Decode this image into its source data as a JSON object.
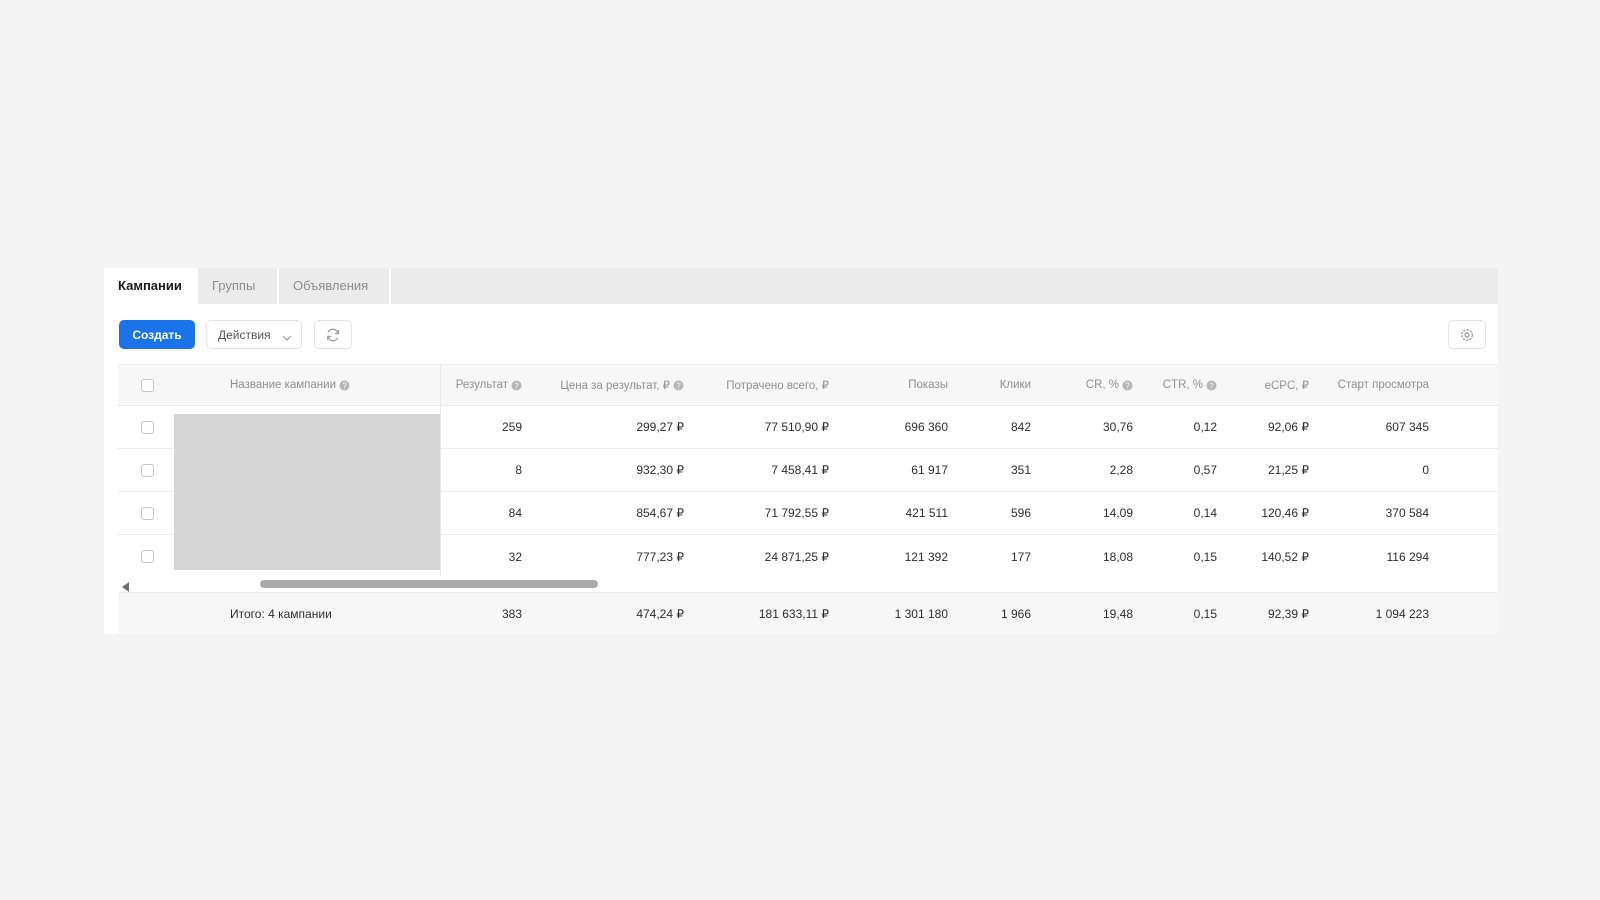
{
  "tabs": [
    {
      "label": "Кампании",
      "active": true
    },
    {
      "label": "Группы",
      "active": false
    },
    {
      "label": "Объявления",
      "active": false
    }
  ],
  "toolbar": {
    "create_label": "Создать",
    "actions_label": "Действия",
    "accent_color": "#1a73e8"
  },
  "table": {
    "headers": {
      "name": "Название кампании",
      "result": "Результат",
      "price": "Цена за результат, ₽",
      "spent": "Потрачено всего, ₽",
      "impressions": "Показы",
      "clicks": "Клики",
      "cr": "CR, %",
      "ctr": "CTR, %",
      "ecpc": "eCPC, ₽",
      "start_view": "Старт просмотра"
    },
    "rows": [
      {
        "result": "259",
        "price": "299,27 ₽",
        "spent": "77 510,90 ₽",
        "impressions": "696 360",
        "clicks": "842",
        "cr": "30,76",
        "ctr": "0,12",
        "ecpc": "92,06 ₽",
        "start_view": "607 345"
      },
      {
        "result": "8",
        "price": "932,30 ₽",
        "spent": "7 458,41 ₽",
        "impressions": "61 917",
        "clicks": "351",
        "cr": "2,28",
        "ctr": "0,57",
        "ecpc": "21,25 ₽",
        "start_view": "0"
      },
      {
        "result": "84",
        "price": "854,67 ₽",
        "spent": "71 792,55 ₽",
        "impressions": "421 511",
        "clicks": "596",
        "cr": "14,09",
        "ctr": "0,14",
        "ecpc": "120,46 ₽",
        "start_view": "370 584"
      },
      {
        "result": "32",
        "price": "777,23 ₽",
        "spent": "24 871,25 ₽",
        "impressions": "121 392",
        "clicks": "177",
        "cr": "18,08",
        "ctr": "0,15",
        "ecpc": "140,52 ₽",
        "start_view": "116 294"
      }
    ],
    "totals": {
      "label": "Итого: 4 кампании",
      "result": "383",
      "price": "474,24 ₽",
      "spent": "181 633,11 ₽",
      "impressions": "1 301 180",
      "clicks": "1 966",
      "cr": "19,48",
      "ctr": "0,15",
      "ecpc": "92,39 ₽",
      "start_view": "1 094 223"
    }
  }
}
